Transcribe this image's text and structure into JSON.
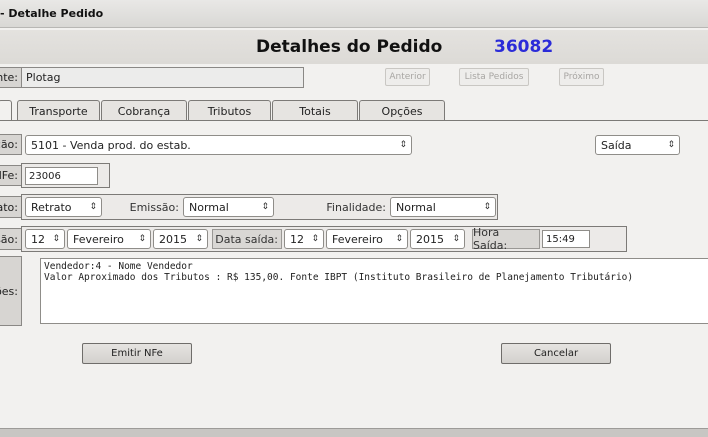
{
  "window": {
    "title": "- Detalhe Pedido"
  },
  "header": {
    "title": "Detalhes do Pedido",
    "order_number": "36082"
  },
  "client": {
    "label": "nte:",
    "value": "Plotag",
    "nav": {
      "prev": "Anterior",
      "list": "Lista Pedidos",
      "next": "Próximo"
    }
  },
  "tabs": [
    "Transporte",
    "Cobrança",
    "Tributos",
    "Totais",
    "Opções"
  ],
  "operation": {
    "label": "ção:",
    "value": "5101 - Venda prod. do estab.",
    "direction": "Saída"
  },
  "nfe": {
    "label": "NFe:",
    "value": "23006"
  },
  "format": {
    "label": "ato:",
    "value": "Retrato",
    "emission_label": "Emissão:",
    "emission_value": "Normal",
    "purpose_label": "Finalidade:",
    "purpose_value": "Normal"
  },
  "dates": {
    "label": "são:",
    "day": "12",
    "month": "Fevereiro",
    "year": "2015",
    "exit_label": "Data saída:",
    "exit_day": "12",
    "exit_month": "Fevereiro",
    "exit_year": "2015",
    "time_label": "Hora Saída:",
    "time_value": "15:49"
  },
  "notes": {
    "label": "ões:",
    "line1": "Vendedor:4 - Nome Vendedor",
    "line2": "Valor Aproximado dos Tributos : R$ 135,00. Fonte IBPT (Instituto Brasileiro de Planejamento Tributário)"
  },
  "actions": {
    "emit": "Emitir NFe",
    "cancel": "Cancelar"
  }
}
